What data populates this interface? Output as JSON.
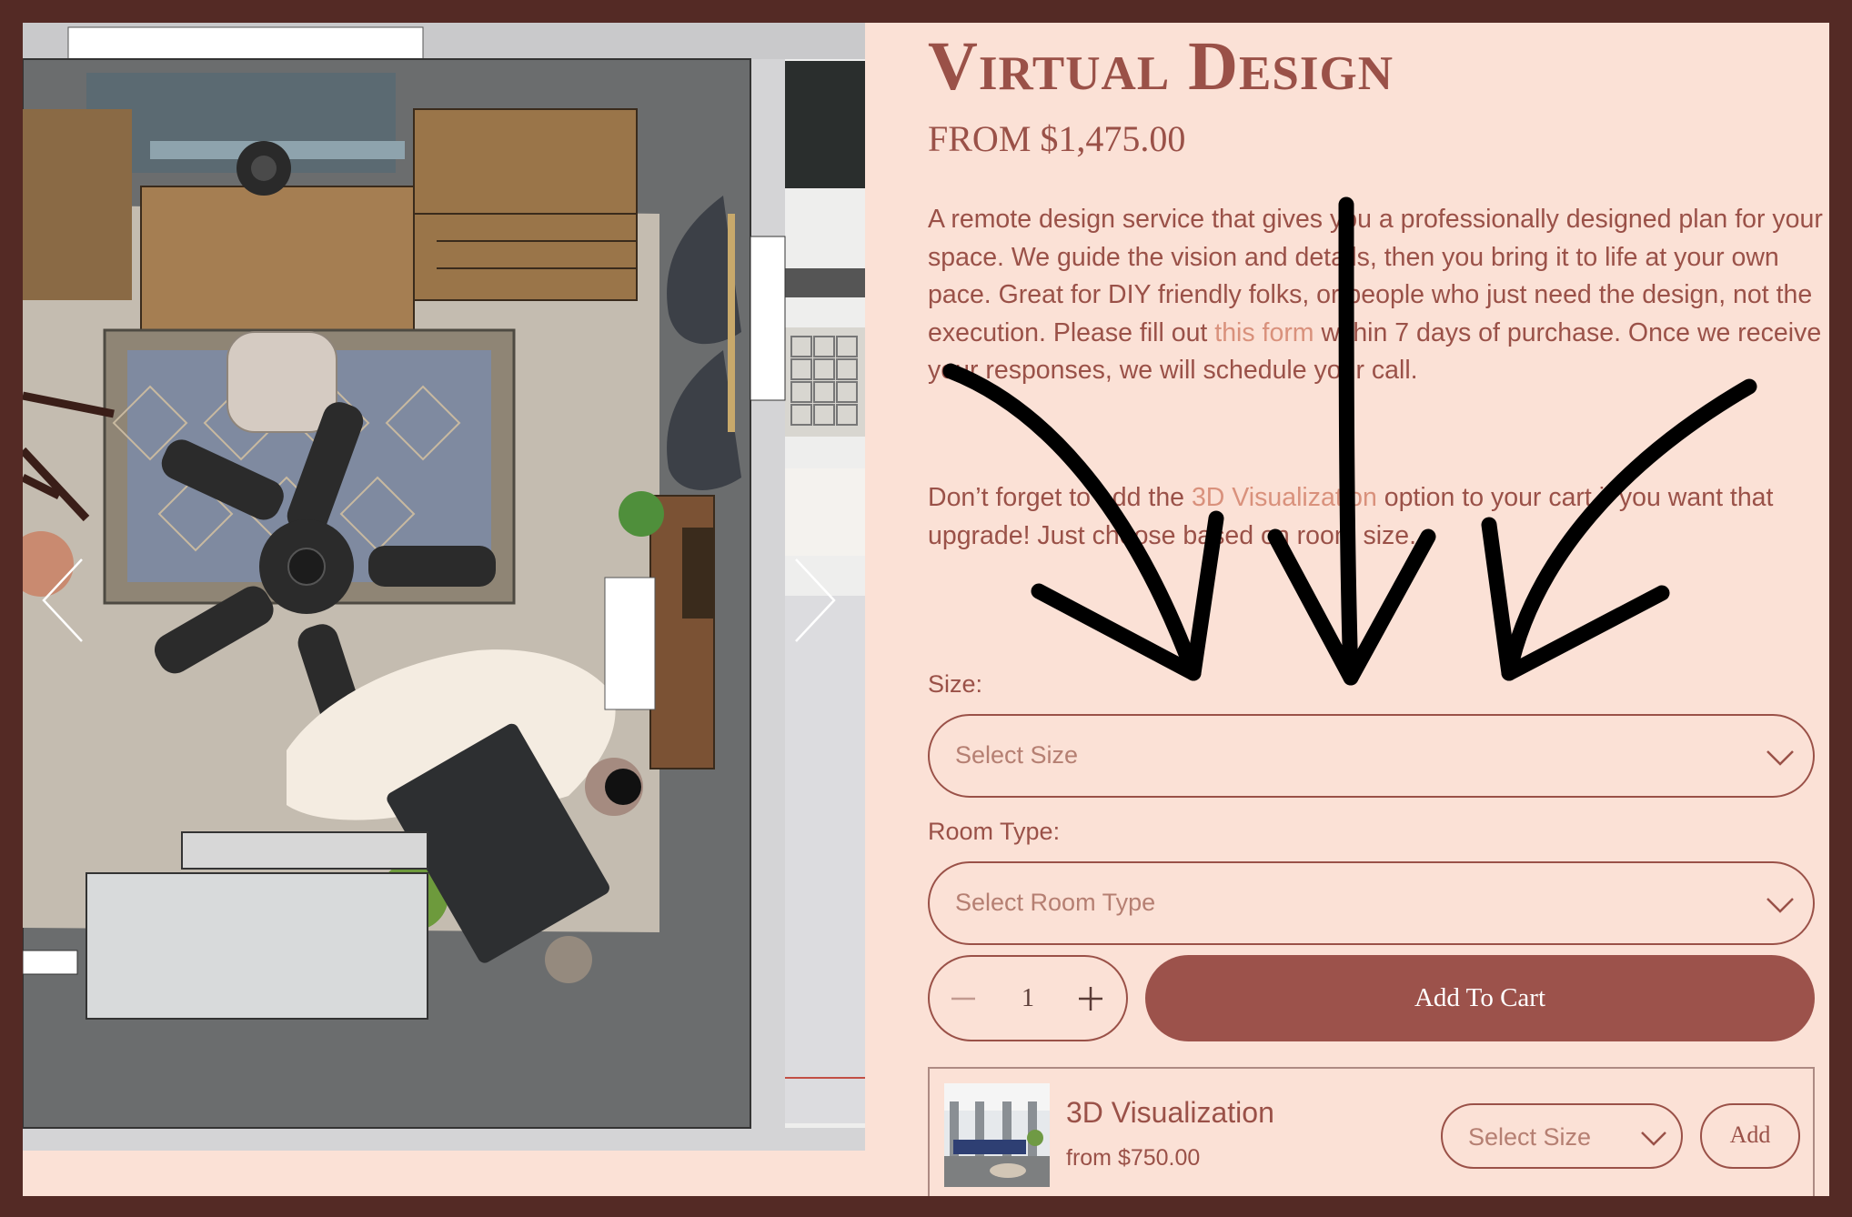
{
  "product": {
    "title": "Virtual Design",
    "price": "FROM $1,475.00",
    "description_part1": "A remote design service that gives you a professionally designed plan for your space. We guide the vision and details, then you bring it to life at your own pace. Great for DIY friendly folks, or people who just need the design, not the execution. Please fill out ",
    "description_link": "this form",
    "description_part2": " within 7 days of purchase. Once we receive your responses, we will schedule your call.",
    "reminder_part1": "Don’t forget to add the ",
    "reminder_link": "3D Visualization",
    "reminder_part2": " option to your cart if you want that upgrade! Just choose based on room size."
  },
  "options": {
    "size_label": "Size:",
    "size_placeholder": "Select Size",
    "room_type_label": "Room Type:",
    "room_type_placeholder": "Select Room Type"
  },
  "cart": {
    "quantity": "1",
    "add_to_cart_label": "Add To Cart"
  },
  "addon": {
    "name": "3D Visualization",
    "price": "from $750.00",
    "size_placeholder": "Select Size",
    "add_label": "Add"
  },
  "colors": {
    "frame": "#542a25",
    "background": "#fbe1d6",
    "accent": "#9c524b",
    "link": "#d9917c"
  },
  "icons": [
    "chevron-left-icon",
    "chevron-right-icon",
    "chevron-down-icon",
    "minus-icon",
    "plus-icon",
    "arrow-annotation-icon"
  ]
}
